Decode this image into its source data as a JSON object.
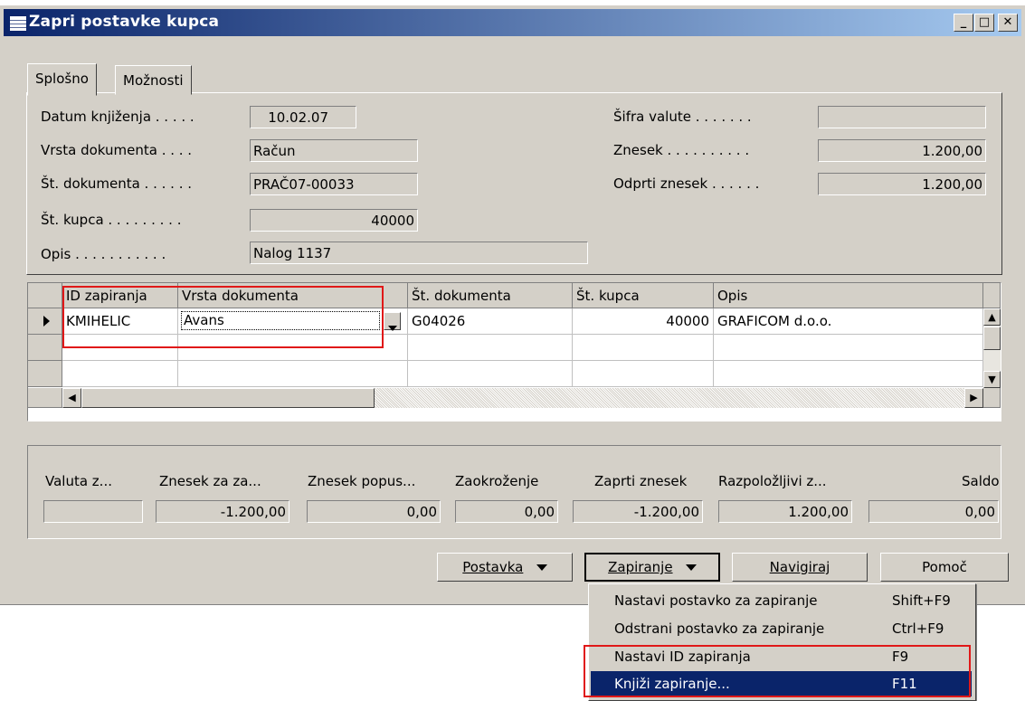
{
  "window": {
    "title": "Zapri postavke kupca",
    "minimize": "_",
    "maximize": "□",
    "close": "✕"
  },
  "tabs": [
    "Splošno",
    "Možnosti"
  ],
  "general": {
    "datum_label": "Datum knjiženja . . . . .",
    "datum_value": "10.02.07",
    "vrsta_label": "Vrsta dokumenta . . . .",
    "vrsta_value": "Račun",
    "st_dok_label": "Št. dokumenta . . . . . .",
    "st_dok_value": "PRAČ07-00033",
    "st_kupca_label": "Št. kupca . . . . . . . . .",
    "st_kupca_value": "40000",
    "opis_label": "Opis . . . . . . . . . . .",
    "opis_value": "Nalog 1137",
    "sifra_label": "Šifra valute . . . . . . .",
    "sifra_value": "",
    "znesek_label": "Znesek . . . . . . . . . .",
    "znesek_value": "1.200,00",
    "odprti_label": "Odprti znesek . . . . . .",
    "odprti_value": "1.200,00"
  },
  "grid": {
    "columns": [
      "ID zapiranja",
      "Vrsta dokumenta",
      "Št. dokumenta",
      "Št. kupca",
      "Opis"
    ],
    "rows": [
      {
        "id": "KMIHELIC",
        "vrsta": "Avans",
        "st_dok": "G04026",
        "st_kupca": "40000",
        "opis": "GRAFICOM d.o.o."
      }
    ]
  },
  "totals": {
    "labels": [
      "Valuta z...",
      "Znesek za za...",
      "Znesek popus...",
      "Zaokroženje",
      "Zaprti znesek",
      "Razpoložljivi z...",
      "Saldo"
    ],
    "values": [
      "",
      "-1.200,00",
      "0,00",
      "0,00",
      "-1.200,00",
      "1.200,00",
      "0,00"
    ]
  },
  "buttons": {
    "postavka": "Postavka",
    "zapiranje": "Zapiranje",
    "navigiraj": "Navigiraj",
    "pomoc": "Pomoč"
  },
  "menu": {
    "items": [
      {
        "label": "Nastavi postavko za zapiranje",
        "shortcut": "Shift+F9"
      },
      {
        "label": "Odstrani postavko za zapiranje",
        "shortcut": "Ctrl+F9"
      },
      {
        "label": "Nastavi ID zapiranja",
        "shortcut": "F9"
      },
      {
        "label": "Knjiži zapiranje...",
        "shortcut": "F11"
      }
    ]
  },
  "colors": {
    "titlebar": "#0a246a",
    "highlight": "#e01818",
    "selected": "#0a246a"
  }
}
